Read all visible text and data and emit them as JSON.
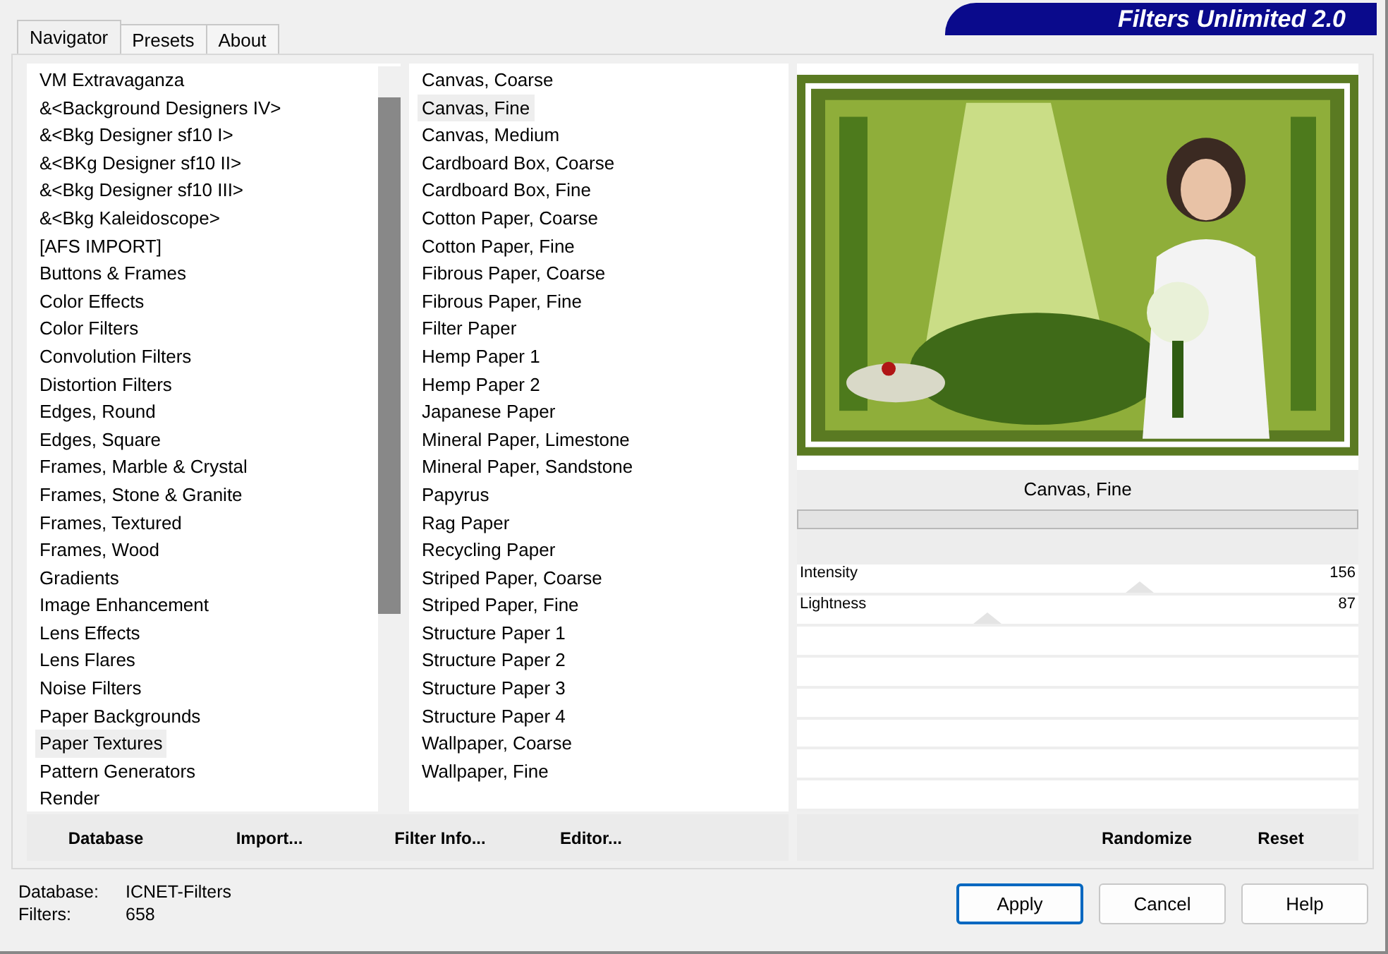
{
  "tabs": [
    {
      "label": "Navigator",
      "selected": true
    },
    {
      "label": "Presets",
      "selected": false
    },
    {
      "label": "About",
      "selected": false
    }
  ],
  "banner": {
    "title": "Filters Unlimited 2.0"
  },
  "categories": [
    {
      "label": "VM Extravaganza",
      "selected": false
    },
    {
      "label": "&<Background Designers IV>",
      "selected": false
    },
    {
      "label": "&<Bkg Designer sf10 I>",
      "selected": false
    },
    {
      "label": "&<BKg Designer sf10 II>",
      "selected": false
    },
    {
      "label": "&<Bkg Designer sf10 III>",
      "selected": false
    },
    {
      "label": "&<Bkg Kaleidoscope>",
      "selected": false
    },
    {
      "label": "[AFS IMPORT]",
      "selected": false
    },
    {
      "label": "Buttons & Frames",
      "selected": false
    },
    {
      "label": "Color Effects",
      "selected": false
    },
    {
      "label": "Color Filters",
      "selected": false
    },
    {
      "label": "Convolution Filters",
      "selected": false
    },
    {
      "label": "Distortion Filters",
      "selected": false
    },
    {
      "label": "Edges, Round",
      "selected": false
    },
    {
      "label": "Edges, Square",
      "selected": false
    },
    {
      "label": "Frames, Marble & Crystal",
      "selected": false
    },
    {
      "label": "Frames, Stone & Granite",
      "selected": false
    },
    {
      "label": "Frames, Textured",
      "selected": false
    },
    {
      "label": "Frames, Wood",
      "selected": false
    },
    {
      "label": "Gradients",
      "selected": false
    },
    {
      "label": "Image Enhancement",
      "selected": false
    },
    {
      "label": "Lens Effects",
      "selected": false
    },
    {
      "label": "Lens Flares",
      "selected": false
    },
    {
      "label": "Noise Filters",
      "selected": false
    },
    {
      "label": "Paper Backgrounds",
      "selected": false
    },
    {
      "label": "Paper Textures",
      "selected": true
    },
    {
      "label": "Pattern Generators",
      "selected": false
    },
    {
      "label": "Render",
      "selected": false
    }
  ],
  "filters": [
    {
      "label": "Canvas, Coarse",
      "selected": false
    },
    {
      "label": "Canvas, Fine",
      "selected": true
    },
    {
      "label": "Canvas, Medium",
      "selected": false
    },
    {
      "label": "Cardboard Box, Coarse",
      "selected": false
    },
    {
      "label": "Cardboard Box, Fine",
      "selected": false
    },
    {
      "label": "Cotton Paper, Coarse",
      "selected": false
    },
    {
      "label": "Cotton Paper, Fine",
      "selected": false
    },
    {
      "label": "Fibrous Paper, Coarse",
      "selected": false
    },
    {
      "label": "Fibrous Paper, Fine",
      "selected": false
    },
    {
      "label": "Filter Paper",
      "selected": false
    },
    {
      "label": "Hemp Paper 1",
      "selected": false
    },
    {
      "label": "Hemp Paper 2",
      "selected": false
    },
    {
      "label": "Japanese Paper",
      "selected": false
    },
    {
      "label": "Mineral Paper, Limestone",
      "selected": false
    },
    {
      "label": "Mineral Paper, Sandstone",
      "selected": false
    },
    {
      "label": "Papyrus",
      "selected": false
    },
    {
      "label": "Rag Paper",
      "selected": false
    },
    {
      "label": "Recycling Paper",
      "selected": false
    },
    {
      "label": "Striped Paper, Coarse",
      "selected": false
    },
    {
      "label": "Striped Paper, Fine",
      "selected": false
    },
    {
      "label": "Structure Paper 1",
      "selected": false
    },
    {
      "label": "Structure Paper 2",
      "selected": false
    },
    {
      "label": "Structure Paper 3",
      "selected": false
    },
    {
      "label": "Structure Paper 4",
      "selected": false
    },
    {
      "label": "Wallpaper, Coarse",
      "selected": false
    },
    {
      "label": "Wallpaper, Fine",
      "selected": false
    }
  ],
  "preview": {
    "filter_name": "Canvas, Fine",
    "progress": {
      "level": 0
    }
  },
  "sliders": [
    {
      "label": "Intensity",
      "level": 0.61,
      "reading": "156"
    },
    {
      "label": "Lightness",
      "level": 0.34,
      "reading": "87"
    }
  ],
  "left_buttons": [
    "Database",
    "Import...",
    "Filter Info...",
    "Editor..."
  ],
  "right_buttons": [
    "Randomize",
    "Reset"
  ],
  "info": [
    {
      "label": "Database:",
      "value": "ICNET-Filters"
    },
    {
      "label": "Filters:",
      "value": "658"
    }
  ],
  "dialog_buttons": [
    {
      "label": "Apply",
      "default": true
    },
    {
      "label": "Cancel",
      "default": false
    },
    {
      "label": "Help",
      "default": false
    }
  ]
}
